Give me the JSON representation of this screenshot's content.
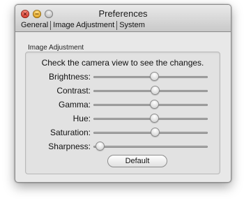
{
  "window": {
    "title": "Preferences"
  },
  "tabs": [
    "General",
    "Image Adjustment",
    "System"
  ],
  "group": {
    "label": "Image Adjustment",
    "hint": "Check the camera view to see the changes."
  },
  "sliders": [
    {
      "label": "Brightness:",
      "value": 0.53
    },
    {
      "label": "Contrast:",
      "value": 0.54
    },
    {
      "label": "Gamma:",
      "value": 0.53
    },
    {
      "label": "Hue:",
      "value": 0.53
    },
    {
      "label": "Saturation:",
      "value": 0.54
    },
    {
      "label": "Sharpness:",
      "value": 0.02
    }
  ],
  "buttons": {
    "default_label": "Default"
  },
  "colors": {
    "close": "#d9382a",
    "minimize": "#e0a11c",
    "zoom": "#bdbdbd"
  }
}
